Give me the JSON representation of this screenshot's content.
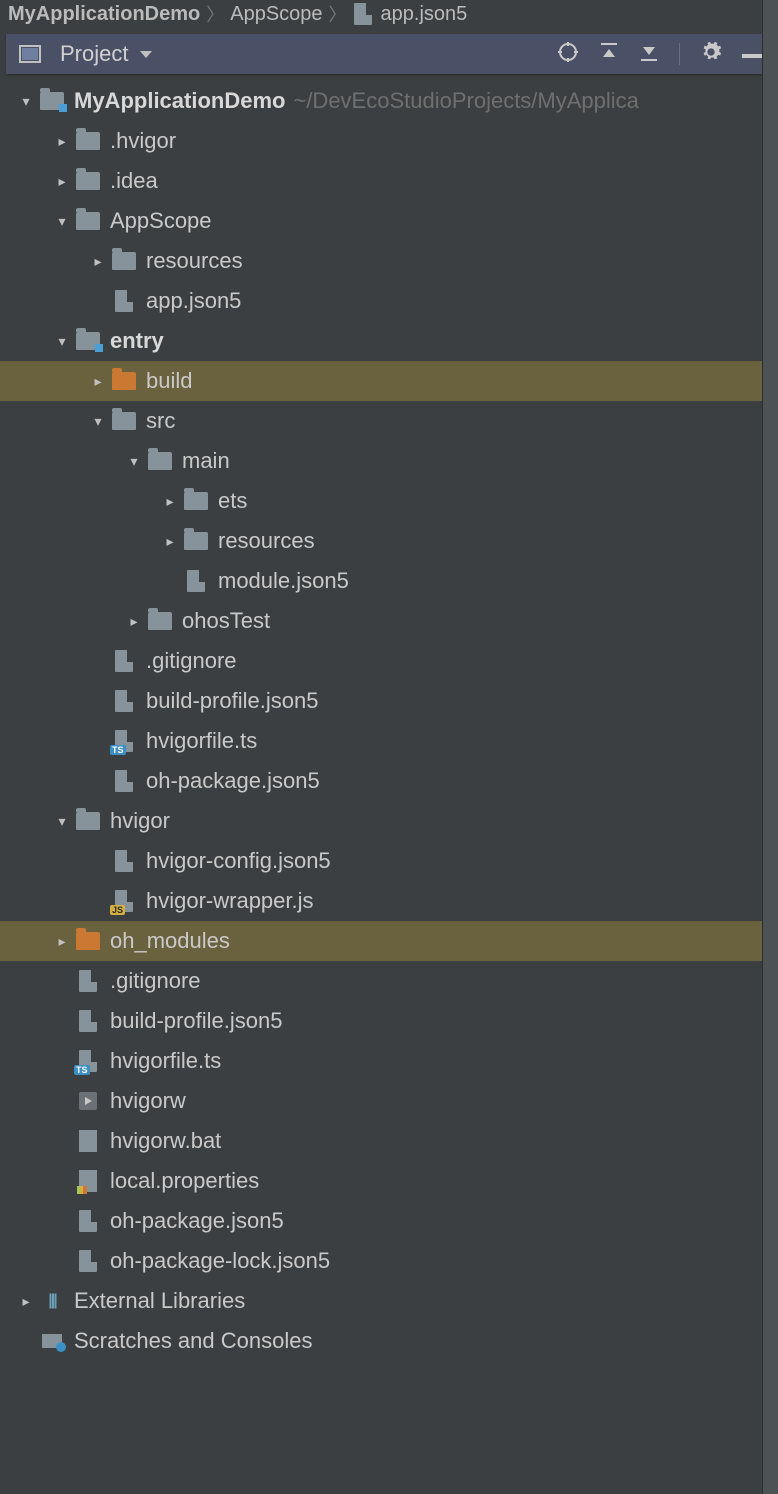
{
  "breadcrumb": {
    "root": "MyApplicationDemo",
    "mid": "AppScope",
    "leaf": "app.json5"
  },
  "toolbar": {
    "view": "Project"
  },
  "tree": {
    "project": {
      "name": "MyApplicationDemo",
      "path": "~/DevEcoStudioProjects/MyApplica"
    },
    "hvigorDir": ".hvigor",
    "ideaDir": ".idea",
    "appScope": {
      "name": "AppScope",
      "resources": "resources",
      "appjson": "app.json5"
    },
    "entry": {
      "name": "entry",
      "build": "build",
      "src": {
        "name": "src",
        "main": {
          "name": "main",
          "ets": "ets",
          "resources": "resources",
          "module": "module.json5"
        },
        "ohosTest": "ohosTest"
      },
      "gitignore": ".gitignore",
      "buildProfile": "build-profile.json5",
      "hvigorfile": "hvigorfile.ts",
      "ohPackage": "oh-package.json5"
    },
    "hvigor": {
      "name": "hvigor",
      "config": "hvigor-config.json5",
      "wrapper": "hvigor-wrapper.js"
    },
    "ohModules": "oh_modules",
    "rootFiles": {
      "gitignore": ".gitignore",
      "buildProfile": "build-profile.json5",
      "hvigorfile": "hvigorfile.ts",
      "hvigorw": "hvigorw",
      "hvigorwBat": "hvigorw.bat",
      "localProps": "local.properties",
      "ohPackage": "oh-package.json5",
      "ohPackageLock": "oh-package-lock.json5"
    },
    "externalLibs": "External Libraries",
    "scratches": "Scratches and Consoles"
  }
}
